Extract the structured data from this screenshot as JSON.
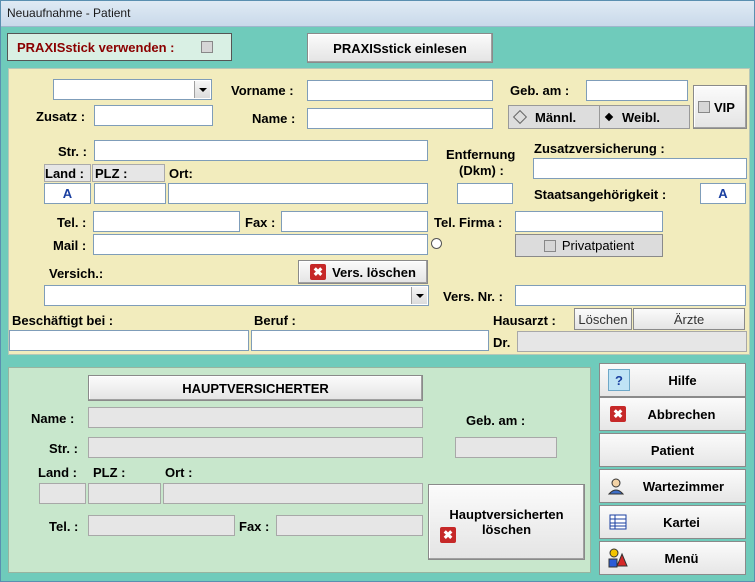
{
  "window": {
    "title": "Neuaufnahme - Patient"
  },
  "top": {
    "praxis_use_label": "PRAXISstick verwenden :",
    "praxis_read_label": "PRAXISstick einlesen"
  },
  "form": {
    "zusatz": "Zusatz :",
    "vorname": "Vorname :",
    "name": "Name :",
    "geb_am": "Geb. am :",
    "maennl": "Männl.",
    "weibl": "Weibl.",
    "vip": "VIP",
    "str": "Str. :",
    "entfernung": "Entfernung",
    "dkm": "(Dkm) :",
    "zusatzversicherung": "Zusatzversicherung :",
    "land": "Land :",
    "plz": "PLZ :",
    "ort": "Ort:",
    "land_value": "A",
    "staatsangehoerigkeit": "Staatsangehörigkeit :",
    "staat_value": "A",
    "tel": "Tel. :",
    "fax": "Fax :",
    "tel_firma": "Tel. Firma :",
    "privatpatient": "Privatpatient",
    "mail": "Mail :",
    "versich": "Versich.:",
    "vers_loeschen": "Vers. löschen",
    "vers_nr": "Vers. Nr. :",
    "beschaeftigt": "Beschäftigt bei :",
    "beruf": "Beruf :",
    "hausarzt": "Hausarzt :",
    "loeschen": "Löschen",
    "aerzte": "Ärzte",
    "dr": "Dr."
  },
  "haupt": {
    "title": "HAUPTVERSICHERTER",
    "name": "Name :",
    "str": "Str. :",
    "geb_am": "Geb. am :",
    "land": "Land :",
    "plz": "PLZ :",
    "ort": "Ort :",
    "tel": "Tel. :",
    "fax": "Fax :",
    "delete_line1": "Hauptversicherten",
    "delete_line2": "löschen"
  },
  "side": {
    "hilfe": "Hilfe",
    "abbrechen": "Abbrechen",
    "patient": "Patient",
    "wartezimmer": "Wartezimmer",
    "kartei": "Kartei",
    "menue": "Menü"
  },
  "colors": {
    "background": "#6fcbbb",
    "panel_top": "#f2ecbd",
    "panel_bottom": "#c8e7cc",
    "praxis_label": "#8b0000",
    "accent_blue": "#1a3fa0"
  },
  "icons": {
    "dropdown": "chevron-down-icon",
    "delete": "red-x-icon",
    "help": "question-icon",
    "waiting": "person-icon",
    "records": "grid-icon",
    "menu": "shapes-icon"
  }
}
